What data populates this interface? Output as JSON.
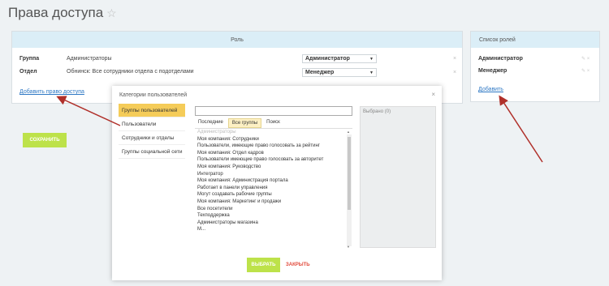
{
  "page": {
    "title": "Права доступа"
  },
  "rights": {
    "header": "Роль",
    "rows": [
      {
        "label": "Группа",
        "value": "Администраторы",
        "role": "Администратор"
      },
      {
        "label": "Отдел",
        "value": "Обнинск: Все сотрудники отдела с подотделами",
        "role": "Менеджер"
      }
    ],
    "add_link": "Добавить право доступа"
  },
  "roles": {
    "header": "Список ролей",
    "items": [
      "Администратор",
      "Менеджер"
    ],
    "add_link": "Добавить"
  },
  "save_button": "СОХРАНИТЬ",
  "dialog": {
    "title": "Категории пользователей",
    "categories": [
      "Группы пользователей",
      "Пользователи",
      "Сотрудники и отделы",
      "Группы социальной сети"
    ],
    "tabs": [
      "Последние",
      "Все группы",
      "Поиск"
    ],
    "list": [
      "Администраторы",
      "Моя компания: Сотрудники",
      "Пользователи, имеющие право голосовать за рейтинг",
      "Моя компания: Отдел кадров",
      "Пользователи имеющие право голосовать за авторитет",
      "Моя компания: Руководство",
      "Интегратор",
      "Моя компания: Администрация портала",
      "Работает в панели управления",
      "Могут создавать рабочие группы",
      "Моя компания: Маркетинг и продажи",
      "Все посетители",
      "Техподдержка",
      "Администраторы магазина",
      "М..."
    ],
    "selected_label": "Выбрано (0)",
    "select_button": "ВЫБРАТЬ",
    "close_button": "ЗАКРЫТЬ"
  },
  "colors": {
    "accent_green": "#bde24a",
    "header_blue": "#dbeef7",
    "active_yellow": "#f5cc59",
    "arrow_red": "#b0302a"
  }
}
